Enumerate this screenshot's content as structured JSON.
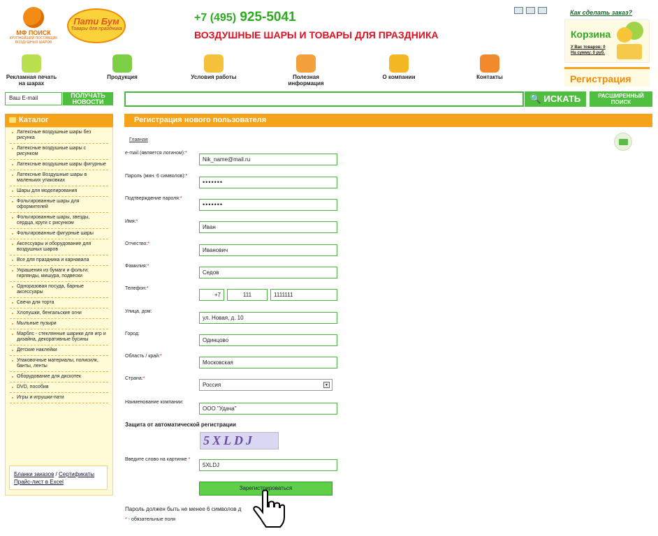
{
  "header": {
    "logo_mf_name": "МФ ПОИСК",
    "logo_mf_sub": "КРУПНЕЙШИЙ ПОСТАВЩИК ВОЗДУШНЫХ ШАРОВ",
    "logo_pati_name": "Пати Бум",
    "logo_pati_sub": "Товары для праздника",
    "phone_prefix": "+7 (495)",
    "phone_number": "925-5041",
    "tagline": "ВОЗДУШНЫЕ ШАРЫ И ТОВАРЫ ДЛЯ ПРАЗДНИКА",
    "how_to_order": "Как сделать заказ?",
    "cart_title": "Корзина",
    "cart_items": "У Вас товаров: 0",
    "cart_sum": "На сумму: 0 руб.",
    "register_link": "Регистрация"
  },
  "nav": [
    {
      "label": "Рекламная печать на шарах"
    },
    {
      "label": "Продукция"
    },
    {
      "label": "Условия работы"
    },
    {
      "label": "Полезная информация"
    },
    {
      "label": "О компании"
    },
    {
      "label": "Контакты"
    }
  ],
  "search": {
    "email_placeholder": "Ваш E-mail",
    "news_button": "ПОЛУЧАТЬ НОВОСТИ",
    "search_button": "ИСКАТЬ",
    "advanced_button": "РАСШИРЕННЫЙ ПОИСК"
  },
  "catalog": {
    "title": "Каталог",
    "items": [
      "Латексные воздушные шары без рисунка",
      "Латексные воздушные шары с рисунком",
      "Латексные воздушные шары фигурные",
      "Латексные Воздушные шары в маленьких упаковках",
      "Шары для моделирования",
      "Фольгированные шары для оформителей",
      "Фольгированные шары, звезды, сердца, круги с рисунком",
      "Фольгированные фигурные шары",
      "Аксессуары и оборудование для воздушных шаров",
      "Все для праздника и карнавала",
      "Украшения из бумаги и фольги: гирлянды, мишура, подвески",
      "Одноразовая посуда, барные аксессуары",
      "Свечи для торта",
      "Хлопушки, бенгальские огни",
      "Мыльные пузыри",
      "Марблс - стеклянные шарики для игр и дизайна, декоративные бусины",
      "Детские наклейки",
      "Упаковочные материалы, полисилк, банты, ленты",
      "Оборудование для дискотек",
      "DVD, пособия",
      "Игры и игрушки-пати"
    ],
    "link_orders": "Бланки заказов",
    "link_sep": " / ",
    "link_certs": "Сертификаты",
    "link_price": "Прайс-лист в Excel"
  },
  "form": {
    "heading": "Регистрация нового пользователя",
    "breadcrumb": "Главная",
    "email_label": "e-mail (является логином):",
    "email_value": "Nik_name@mail.ru",
    "password_label": "Пароль (мин. 6 символов):",
    "password_value": "•••••••",
    "confirm_label": "Подтверждение пароля:",
    "confirm_value": "•••••••",
    "name_label": "Имя:",
    "name_value": "Иван",
    "patronymic_label": "Отчество:",
    "patronymic_value": "Иванович",
    "surname_label": "Фамилия:",
    "surname_value": "Седов",
    "phone_label": "Телефон:",
    "phone_code": "+7",
    "phone_area": "111",
    "phone_number": "1111111",
    "street_label": "Улица, дом:",
    "street_value": "ул. Новая, д. 10",
    "city_label": "Город:",
    "city_value": "Одинцово",
    "region_label": "Область / край:",
    "region_value": "Московская",
    "country_label": "Страна:",
    "country_value": "Россия",
    "company_label": "Наименование компании:",
    "company_value": "ООО \"Удача\"",
    "protection_heading": "Защита от автоматической регистрации",
    "captcha_text": "5XLDJ",
    "captcha_label": "Введите слово на картинке",
    "captcha_value": "5XLDJ",
    "submit": "Зарегистрироваться",
    "note_password": "Пароль должен быть не менее 6 символов д",
    "note_required_star": "*",
    "note_required": " - обязательные поля",
    "req_star": "*"
  },
  "colors": {
    "accent_orange": "#f5a31b",
    "accent_green": "#4fbf3f",
    "accent_red": "#e01020"
  }
}
